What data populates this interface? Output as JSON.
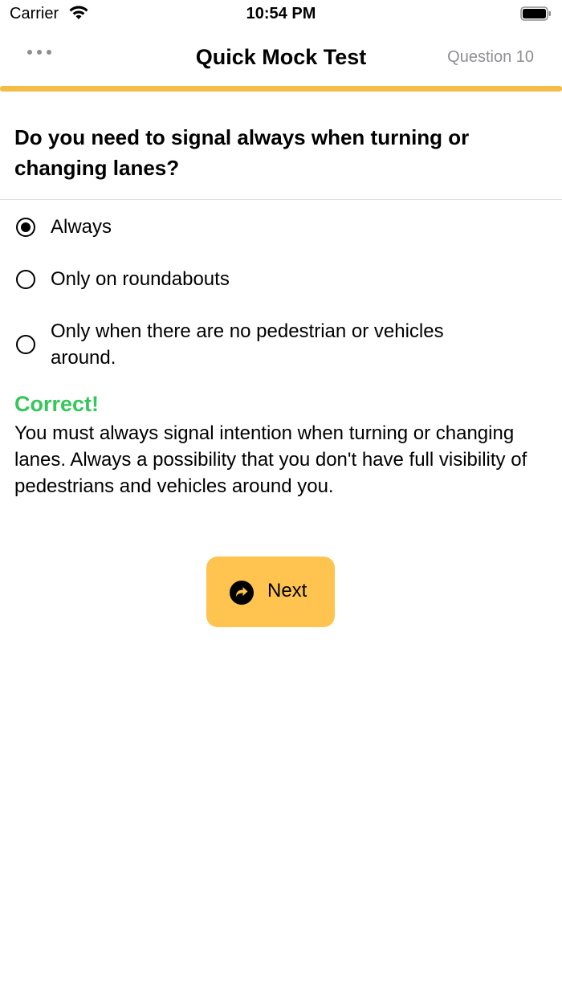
{
  "status_bar": {
    "carrier": "Carrier",
    "time": "10:54 PM"
  },
  "nav": {
    "title": "Quick Mock Test",
    "right_label": "Question 10",
    "more_icon": "ellipsis-icon"
  },
  "progress": {
    "fraction": 1.0,
    "color": "#f3bc47"
  },
  "question": {
    "text": "Do you need to signal always when turning or changing lanes?"
  },
  "options": [
    {
      "label": "Always",
      "selected": true
    },
    {
      "label": "Only on roundabouts",
      "selected": false
    },
    {
      "label": "Only when there are no pedestrian or vehicles around.",
      "selected": false
    }
  ],
  "feedback": {
    "title": "Correct!",
    "text": "You must always signal intention when turning or changing lanes. Always a possibility that you don't have full visibility of pedestrians and vehicles around you.",
    "color": "#34c759"
  },
  "next_button": {
    "label": "Next",
    "icon": "forward-arrow-circle-icon",
    "color": "#fec44f"
  }
}
